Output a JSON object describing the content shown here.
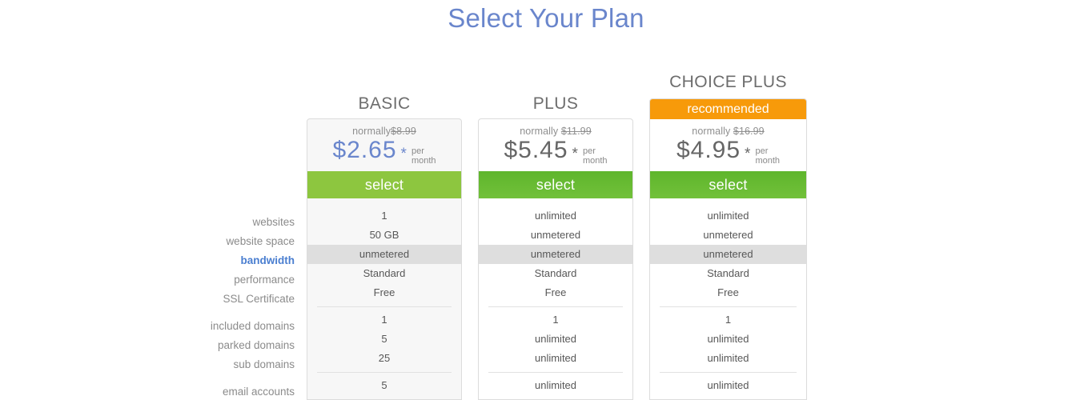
{
  "page": {
    "title": "Select Your Plan",
    "title_color": "#6a86cc"
  },
  "colors": {
    "accent_blue": "#6a86cc",
    "recommended_orange": "#f79a0a",
    "select_green_light": "#8dc63f",
    "select_green_dark": "#5eb52c",
    "highlight_gray": "#dedede"
  },
  "plans": [
    {
      "name": "BASIC",
      "ribbon": "",
      "normally_prefix": "normally",
      "normally_price": "$8.99",
      "price": "$2.65",
      "star": "*",
      "per": "per",
      "month": "month",
      "select_label": "select",
      "values": [
        "1",
        "50 GB",
        "unmetered",
        "Standard",
        "Free",
        "1",
        "5",
        "25",
        "5"
      ]
    },
    {
      "name": "PLUS",
      "ribbon": "",
      "normally_prefix": "normally",
      "normally_price": "$11.99",
      "price": "$5.45",
      "star": "*",
      "per": "per",
      "month": "month",
      "select_label": "select",
      "values": [
        "unlimited",
        "unmetered",
        "unmetered",
        "Standard",
        "Free",
        "1",
        "unlimited",
        "unlimited",
        "unlimited"
      ]
    },
    {
      "name": "CHOICE PLUS",
      "ribbon": "recommended",
      "normally_prefix": "normally",
      "normally_price": "$16.99",
      "price": "$4.95",
      "star": "*",
      "per": "per",
      "month": "month",
      "select_label": "select",
      "values": [
        "unlimited",
        "unmetered",
        "unmetered",
        "Standard",
        "Free",
        "1",
        "unlimited",
        "unlimited",
        "unlimited"
      ]
    }
  ],
  "feature_labels": [
    "websites",
    "website space",
    "bandwidth",
    "performance",
    "SSL Certificate",
    "included domains",
    "parked domains",
    "sub domains",
    "email accounts"
  ],
  "highlighted_feature_index": 2
}
